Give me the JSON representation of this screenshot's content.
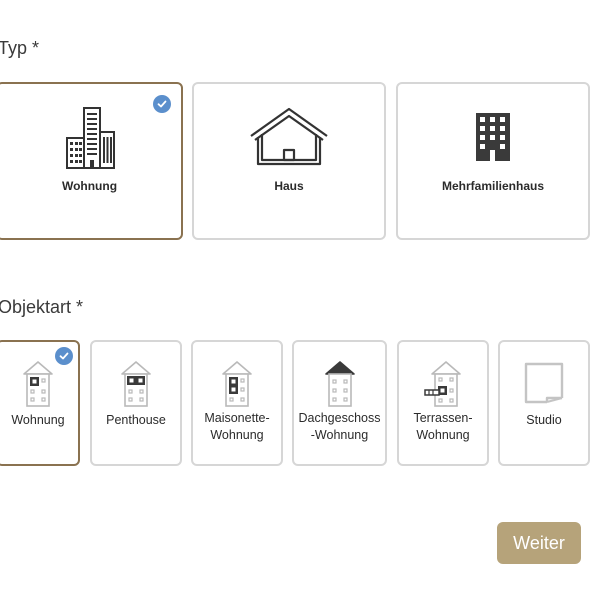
{
  "typ": {
    "label": "Typ *",
    "options": [
      {
        "label": "Wohnung",
        "icon": "apartment-buildings-icon",
        "selected": true
      },
      {
        "label": "Haus",
        "icon": "house-icon",
        "selected": false
      },
      {
        "label": "Mehrfamilienhaus",
        "icon": "multi-family-building-icon",
        "selected": false
      }
    ]
  },
  "objektart": {
    "label": "Objektart *",
    "options": [
      {
        "label": "Wohnung",
        "icon": "apartment-unit-icon",
        "selected": true
      },
      {
        "label": "Penthouse",
        "icon": "penthouse-icon",
        "selected": false
      },
      {
        "label": "Maisonette-\nWohnung",
        "icon": "maisonette-icon",
        "selected": false
      },
      {
        "label": "Dachgeschoss\n-Wohnung",
        "icon": "attic-apartment-icon",
        "selected": false
      },
      {
        "label": "Terrassen-\nWohnung",
        "icon": "terrace-apartment-icon",
        "selected": false
      },
      {
        "label": "Studio",
        "icon": "studio-icon",
        "selected": false
      }
    ]
  },
  "actions": {
    "next_label": "Weiter"
  },
  "colors": {
    "selected_border": "#8a7250",
    "check_badge": "#5b8fcc",
    "primary_button": "#b6a37a"
  }
}
